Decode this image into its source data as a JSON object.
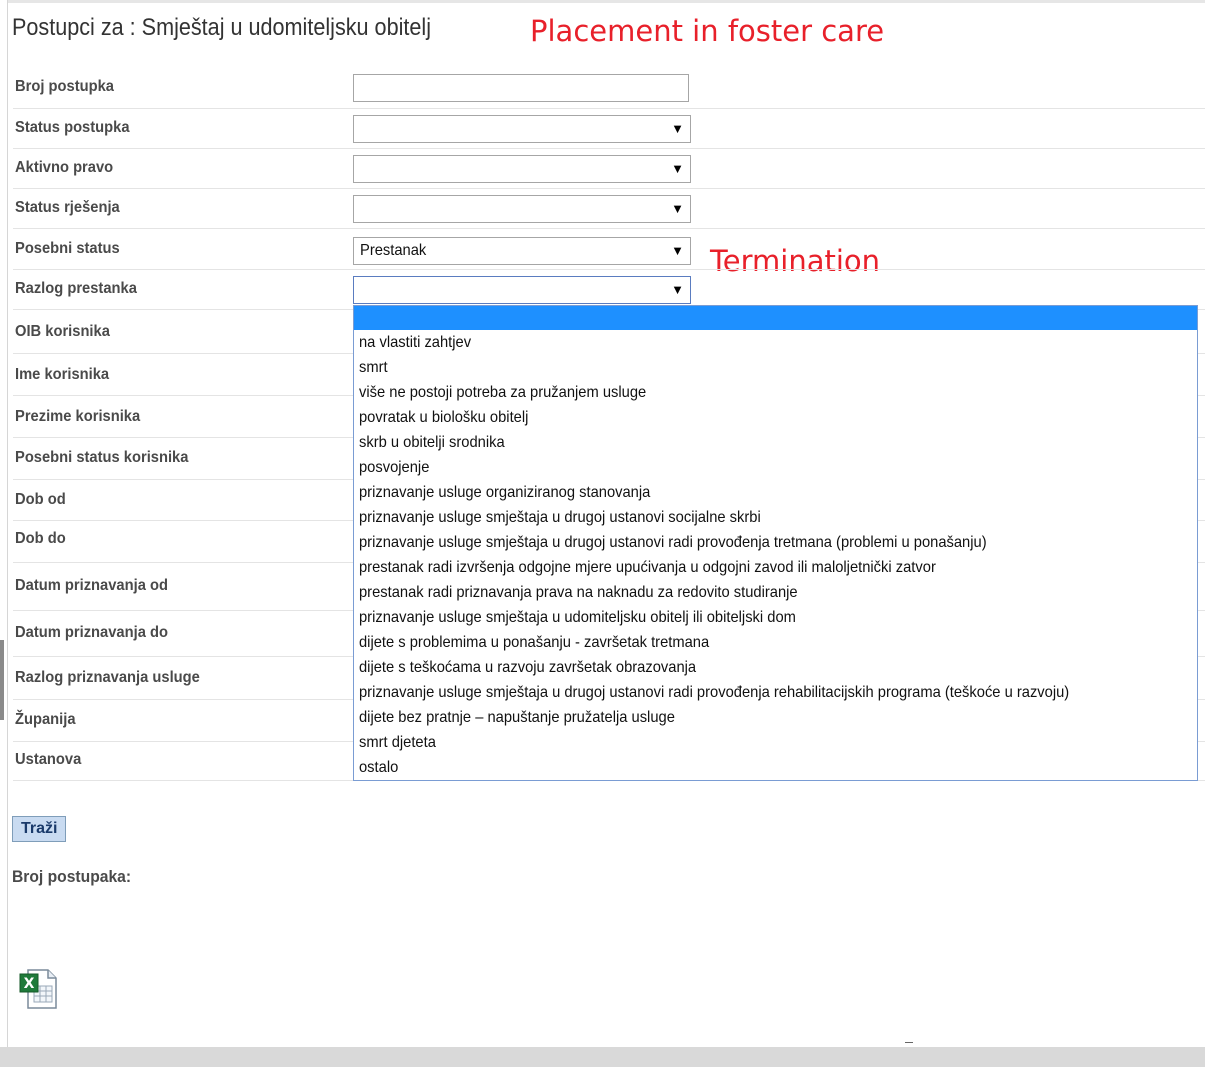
{
  "page": {
    "title": "Postupci za : Smještaj u udomiteljsku obitelj",
    "annotation_title": "Placement in foster care",
    "annotation_termination": "Termination"
  },
  "form": {
    "broj_postupka": {
      "label": "Broj postupka",
      "value": ""
    },
    "status_postupka": {
      "label": "Status postupka",
      "value": ""
    },
    "aktivno_pravo": {
      "label": "Aktivno pravo",
      "value": ""
    },
    "status_rjesenja": {
      "label": "Status rješenja",
      "value": ""
    },
    "posebni_status": {
      "label": "Posebni status",
      "value": "Prestanak"
    },
    "razlog_prestanka": {
      "label": "Razlog prestanka",
      "value": ""
    },
    "oib_korisnika": {
      "label": "OIB korisnika"
    },
    "ime_korisnika": {
      "label": "Ime korisnika"
    },
    "prezime_korisnika": {
      "label": "Prezime korisnika"
    },
    "posebni_status_korisnika": {
      "label": "Posebni status korisnika"
    },
    "dob_od": {
      "label": "Dob od"
    },
    "dob_do": {
      "label": "Dob do"
    },
    "datum_priznavanja_od": {
      "label": "Datum priznavanja od"
    },
    "datum_priznavanja_do": {
      "label": "Datum priznavanja do"
    },
    "razlog_priznavanja_usluge": {
      "label": "Razlog priznavanja usluge"
    },
    "zupanija": {
      "label": "Županija"
    },
    "ustanova": {
      "label": "Ustanova"
    }
  },
  "dropdown": {
    "options": [
      "",
      "na vlastiti zahtjev",
      "smrt",
      "više ne postoji potreba za pružanjem usluge",
      "povratak u biološku obitelj",
      "skrb u obitelji srodnika",
      "posvojenje",
      "priznavanje usluge organiziranog stanovanja",
      "priznavanje usluge smještaja u drugoj ustanovi socijalne skrbi",
      "priznavanje usluge smještaja u drugoj ustanovi radi provođenja tretmana (problemi u ponašanju)",
      "prestanak radi izvršenja odgojne mjere upućivanja u odgojni zavod ili maloljetnički zatvor",
      "prestanak radi priznavanja prava na naknadu za redovito studiranje",
      "priznavanje usluge smještaja u udomiteljsku obitelj ili obiteljski dom",
      "dijete s problemima u ponašanju - završetak tretmana",
      "dijete s teškoćama u razvoju završetak obrazovanja",
      "priznavanje usluge smještaja u drugoj ustanovi radi provođenja rehabilitacijskih programa (teškoće u razvoju)",
      "dijete bez pratnje – napuštanje pružatelja usluge",
      "smrt djeteta",
      "ostalo"
    ]
  },
  "actions": {
    "search_label": "Traži"
  },
  "results": {
    "count_label": "Broj postupaka:"
  },
  "icons": {
    "export": "excel-icon",
    "dropdown_arrow": "▼"
  }
}
